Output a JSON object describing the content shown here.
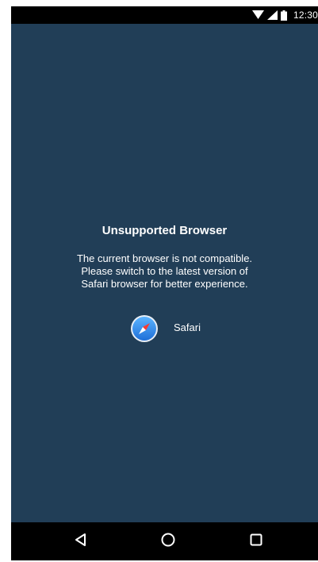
{
  "status_bar": {
    "time": "12:30",
    "icons": [
      "wifi-icon",
      "cellular-signal-icon",
      "battery-icon"
    ]
  },
  "dialog": {
    "title": "Unsupported Browser",
    "message_lines": [
      "The current browser is not compatible.",
      "Please switch to the latest version of",
      "Safari browser for better experience."
    ],
    "browser_option": {
      "icon": "safari-compass-icon",
      "label": "Safari"
    }
  },
  "nav_bar": {
    "buttons": [
      "back-icon",
      "home-icon",
      "recents-icon"
    ]
  },
  "colors": {
    "background": "#213e57",
    "bars": "#000000",
    "text": "#ffffff",
    "safari_blue": "#2f8ef0"
  }
}
